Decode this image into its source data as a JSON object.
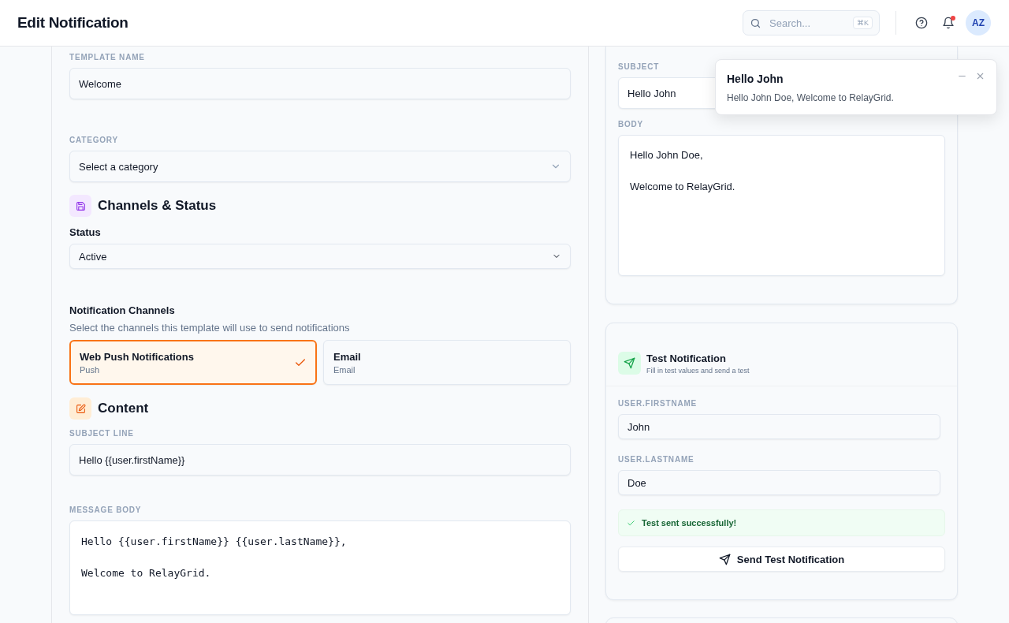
{
  "header": {
    "title": "Edit Notification",
    "search": {
      "placeholder": "Search...",
      "shortcut": "⌘K"
    },
    "notifications_unread": true,
    "avatar": "AZ"
  },
  "form": {
    "template_name": {
      "label": "TEMPLATE NAME",
      "value": "Welcome"
    },
    "category": {
      "label": "CATEGORY",
      "placeholder": "Select a category"
    },
    "channels_section": {
      "title": "Channels & Status"
    },
    "status": {
      "label": "Status",
      "value": "Active"
    },
    "channels": {
      "label": "Notification Channels",
      "hint": "Select the channels this template will use to send notifications",
      "options": [
        {
          "name": "Web Push Notifications",
          "type": "Push",
          "selected": true
        },
        {
          "name": "Email",
          "type": "Email",
          "selected": false
        }
      ]
    },
    "content_section": {
      "title": "Content"
    },
    "subject_line": {
      "label": "SUBJECT LINE",
      "value": "Hello {{user.firstName}}"
    },
    "message_body": {
      "label": "MESSAGE BODY",
      "value": "Hello {{user.firstName}} {{user.lastName}},\n\nWelcome to RelayGrid."
    }
  },
  "preview": {
    "subject": {
      "label": "SUBJECT",
      "value": "Hello John"
    },
    "body": {
      "label": "BODY",
      "value": "Hello John Doe,\n\nWelcome to RelayGrid."
    }
  },
  "test": {
    "title": "Test Notification",
    "subtitle": "Fill in test values and send a test",
    "fields": [
      {
        "label": "USER.FIRSTNAME",
        "value": "John"
      },
      {
        "label": "USER.LASTNAME",
        "value": "Doe"
      }
    ],
    "result": "Test sent successfully!",
    "button": "Send Test Notification"
  },
  "toast": {
    "title": "Hello John",
    "message": "Hello John Doe, Welcome to RelayGrid."
  }
}
